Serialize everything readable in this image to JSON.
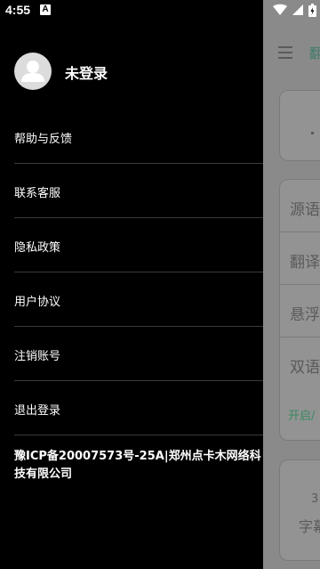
{
  "status_bar": {
    "time": "4:55",
    "notification_icon_letter": "A"
  },
  "drawer": {
    "profile_name": "未登录",
    "menu_items": [
      {
        "label": "帮助与反馈"
      },
      {
        "label": "联系客服"
      },
      {
        "label": "隐私政策"
      },
      {
        "label": "用户协议"
      },
      {
        "label": "注销账号"
      },
      {
        "label": "退出登录"
      }
    ],
    "icp_text": "豫ICP备20007573号-25A|郑州点卡木网络科技有限公司"
  },
  "background_app": {
    "top_peek": "翻",
    "rows": [
      "源语",
      "翻译",
      "悬浮",
      "双语"
    ],
    "green_text": "开启/",
    "bottom_mini": "3",
    "bottom_sub": "字幕"
  },
  "colors": {
    "drawer_bg": "#000000",
    "overlay": "#8a8a8a",
    "accent_green": "#3a8a62",
    "divider": "#3a3a3a"
  }
}
